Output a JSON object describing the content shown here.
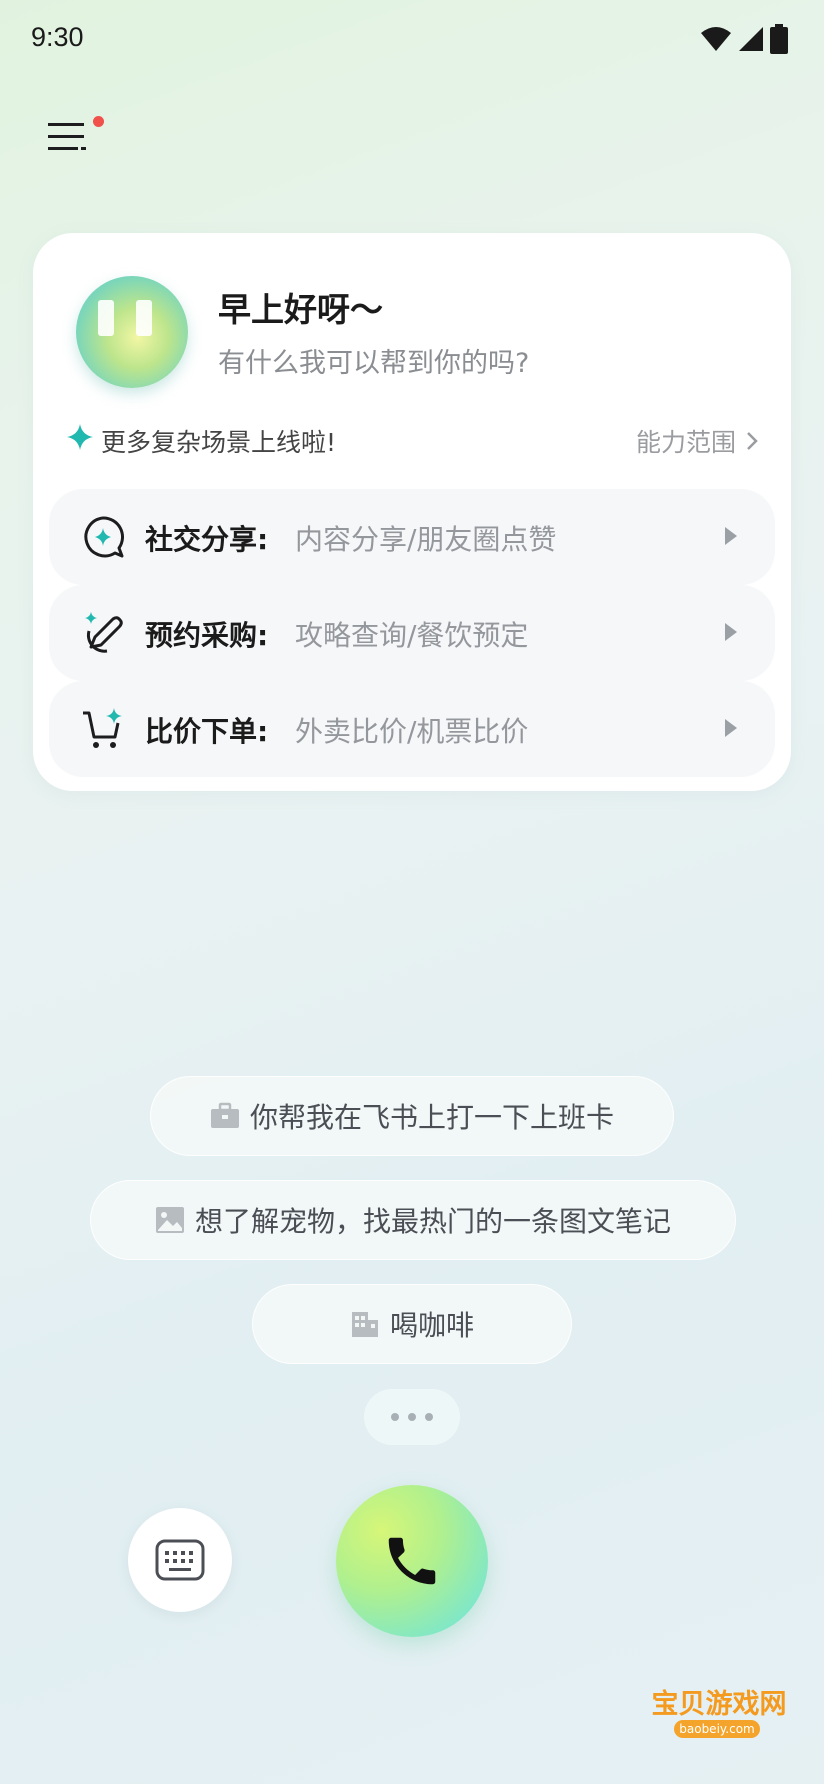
{
  "status_bar": {
    "time": "9:30",
    "icons": [
      "wifi-icon",
      "signal-icon",
      "battery-icon"
    ]
  },
  "header": {
    "menu_icon": "menu-icon",
    "has_notification": true
  },
  "greeting": {
    "title": "早上好呀～",
    "subtitle": "有什么我可以帮到你的吗?"
  },
  "notice": {
    "text": "更多复杂场景上线啦!",
    "link_label": "能力范围"
  },
  "features": [
    {
      "icon": "chat-sparkle-icon",
      "title": "社交分享:",
      "desc": "内容分享/朋友圈点赞"
    },
    {
      "icon": "pen-sparkle-icon",
      "title": "预约采购:",
      "desc": "攻略查询/餐饮预定"
    },
    {
      "icon": "cart-sparkle-icon",
      "title": "比价下单:",
      "desc": "外卖比价/机票比价"
    }
  ],
  "suggestions": [
    {
      "icon": "briefcase-icon",
      "text": "你帮我在飞书上打一下上班卡"
    },
    {
      "icon": "image-icon",
      "text": "想了解宠物，找最热门的一条图文笔记"
    },
    {
      "icon": "building-icon",
      "text": "喝咖啡"
    }
  ],
  "controls": {
    "keyboard_icon": "keyboard-icon",
    "call_icon": "phone-icon"
  },
  "watermark": {
    "title": "宝贝游戏网",
    "subtitle": "baobeiy.com"
  },
  "colors": {
    "accent": "#21b8b0",
    "notification": "#f0514b",
    "call_start": "#d6f678",
    "call_end": "#6fe2d9"
  }
}
